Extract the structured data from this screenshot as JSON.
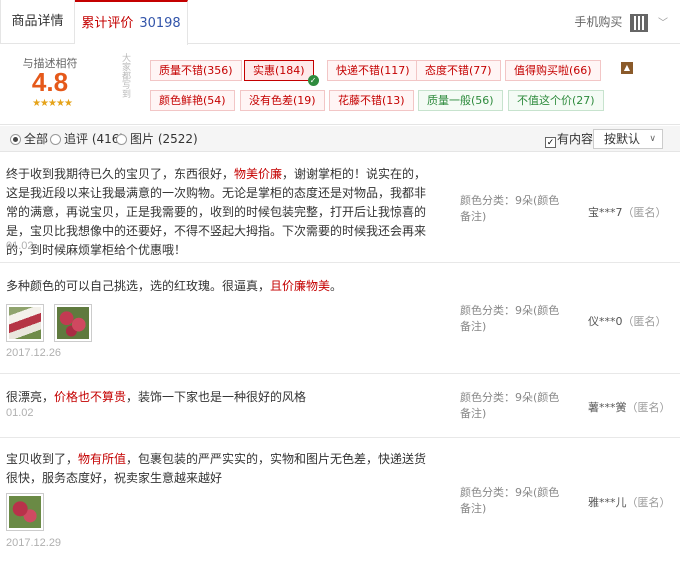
{
  "tabs": {
    "detail": "商品详情",
    "reviews": "累计评价",
    "review_count": "30198",
    "mobile_buy": "手机购买",
    "mobile_icon": "qr-code-icon",
    "chevron": "﹀"
  },
  "rating": {
    "label": "与描述相符",
    "score": "4.8",
    "stars": "★★★★★",
    "side_label": "大家都写到"
  },
  "tags": [
    {
      "label": "质量不错(356)",
      "kind": "neg",
      "selected": false
    },
    {
      "label": "实惠(184)",
      "kind": "neg",
      "selected": true
    },
    {
      "label": "快递不错(117)",
      "kind": "neg",
      "selected": false
    },
    {
      "label": "态度不错(77)",
      "kind": "neg",
      "selected": false
    },
    {
      "label": "值得购买啦(66)",
      "kind": "neg",
      "selected": false
    },
    {
      "label": "颜色鲜艳(54)",
      "kind": "neg",
      "selected": false
    },
    {
      "label": "没有色差(19)",
      "kind": "neg",
      "selected": false
    },
    {
      "label": "花藤不错(13)",
      "kind": "neg",
      "selected": false
    },
    {
      "label": "质量一般(56)",
      "kind": "pos",
      "selected": false
    },
    {
      "label": "不值这个价(27)",
      "kind": "pos",
      "selected": false
    }
  ],
  "filters": {
    "all": "全部",
    "append": "追评 (416)",
    "pictures": "图片 (2522)",
    "has_content": "有内容",
    "sort_label": "按默认",
    "sort_arrow": "∨"
  },
  "reviews": [
    {
      "parts": [
        "终于收到我期待已久的宝贝了，东西很好，",
        "物美价廉",
        "，谢谢掌柜的！说实在的，这是我近段以来让我最满意的一次购物。无论是掌柜的态度还是对物品，我都非常的满意，再说宝贝，正是我需要的，收到的时候包装完整，打开后让我惊喜的是，宝贝比我想像中的还要好，不得不竖起大拇指。下次需要的时候我还会再来的，到时候麻烦掌柜给个优惠哦！"
      ],
      "date": "01.02",
      "spec": "颜色分类：9朵(颜色备注)",
      "user": "宝***7",
      "anon": "（匿名）"
    },
    {
      "parts": [
        "多种颜色的可以自己挑选，选的红玫瑰。很逼真，",
        "且价廉物美",
        "。"
      ],
      "date": "2017.12.26",
      "spec": "颜色分类：9朵(颜色备注)",
      "user": "仪***0",
      "anon": "（匿名）"
    },
    {
      "parts": [
        "很漂亮，",
        "价格也不算贵",
        "，装饰一下家也是一种很好的风格"
      ],
      "date": "01.02",
      "spec": "颜色分类：9朵(颜色备注)",
      "user": "薯***黉",
      "anon": "（匿名）"
    },
    {
      "parts": [
        "宝贝收到了，",
        "物有所值",
        "，包裹包装的严严实实的，实物和图片无色差，快递送货很快，服务态度好，祝卖家生意越来越好"
      ],
      "date": "2017.12.29",
      "spec": "颜色分类：9朵(颜色备注)",
      "user": "雅***儿",
      "anon": "（匿名）"
    }
  ],
  "icons": {
    "check": "✓",
    "collapse": "▲",
    "checkbox_mark": "✓"
  }
}
